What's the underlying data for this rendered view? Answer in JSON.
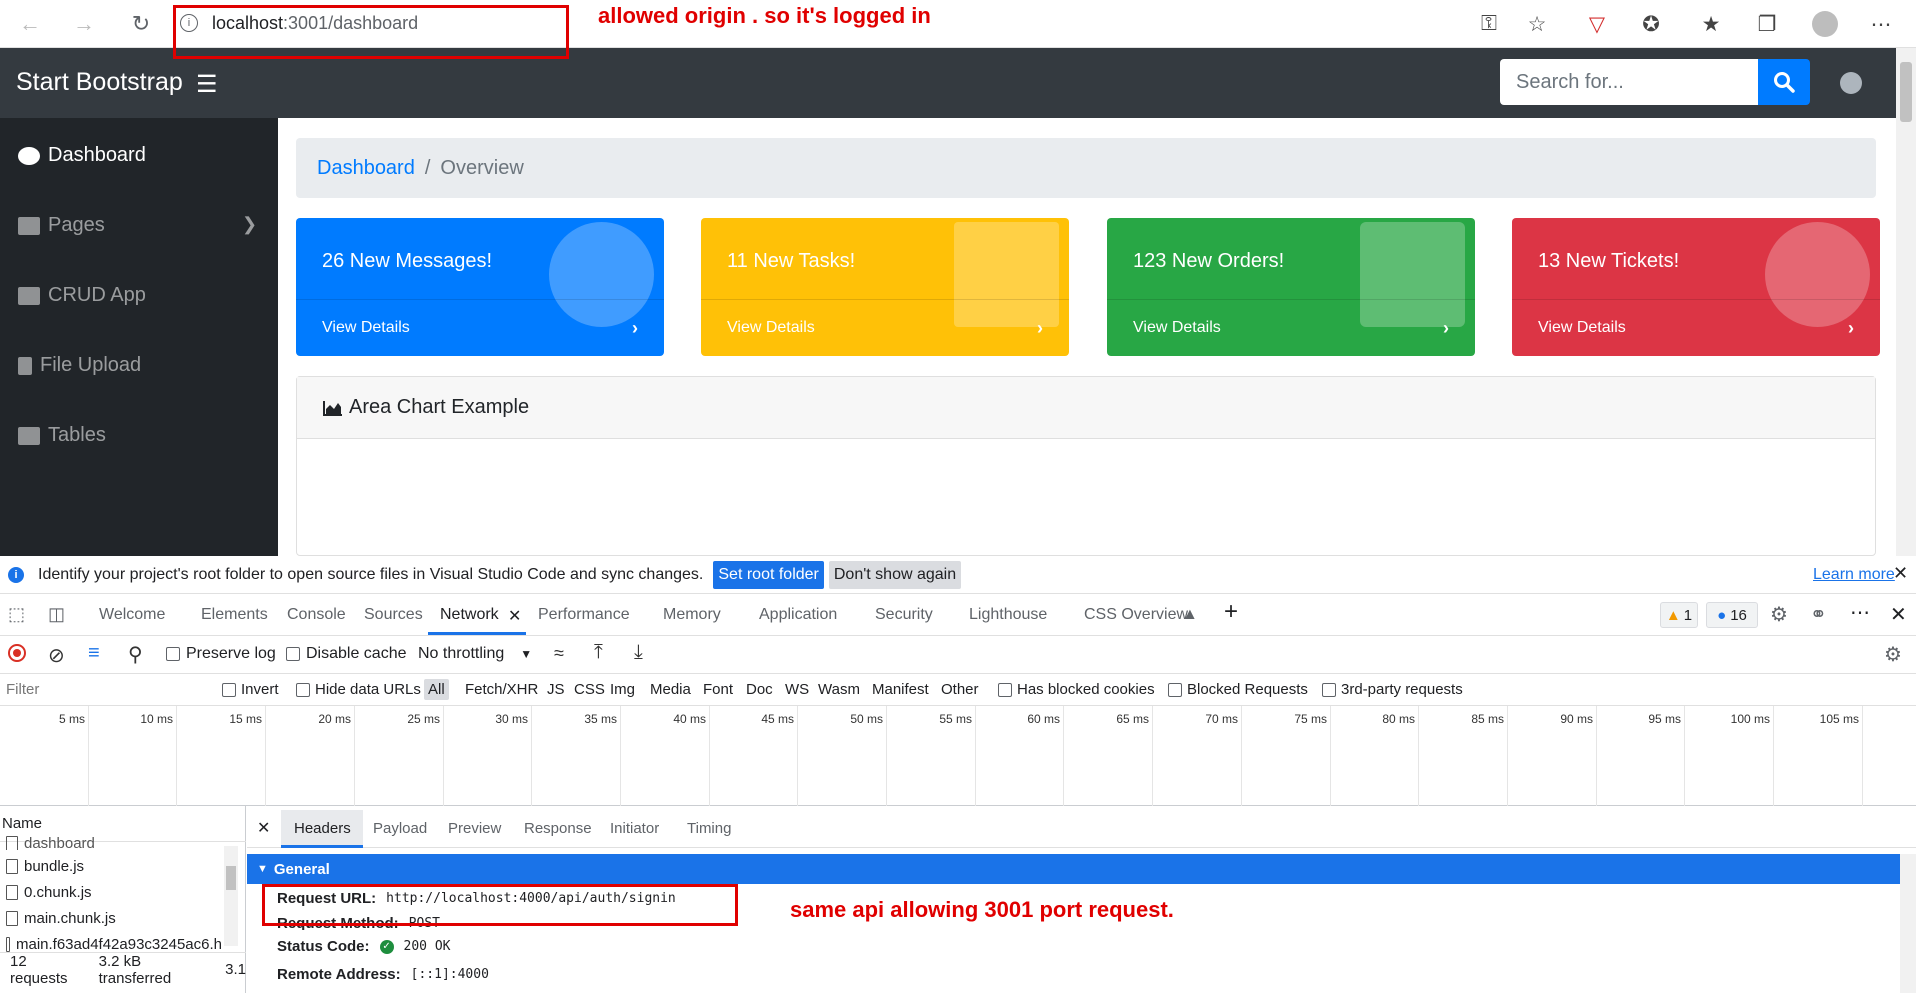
{
  "browser": {
    "url_host": "localhost",
    "url_path": ":3001/dashboard",
    "annotation_top": "allowed origin . so it's logged in"
  },
  "app": {
    "brand": "Start Bootstrap",
    "search_placeholder": "Search for..."
  },
  "sidebar": {
    "items": [
      {
        "label": "Dashboard"
      },
      {
        "label": "Pages"
      },
      {
        "label": "CRUD App"
      },
      {
        "label": "File Upload"
      },
      {
        "label": "Tables"
      }
    ]
  },
  "breadcrumb": {
    "link": "Dashboard",
    "sep": "/",
    "current": "Overview"
  },
  "cards": [
    {
      "title": "26 New Messages!",
      "footer": "View Details",
      "color": "#007bff"
    },
    {
      "title": "11 New Tasks!",
      "footer": "View Details",
      "color": "#ffc107"
    },
    {
      "title": "123 New Orders!",
      "footer": "View Details",
      "color": "#28a745"
    },
    {
      "title": "13 New Tickets!",
      "footer": "View Details",
      "color": "#dc3545"
    }
  ],
  "chart_card": {
    "title": "Area Chart Example"
  },
  "infobar": {
    "text": "Identify your project's root folder to open source files in Visual Studio Code and sync changes.",
    "set_root": "Set root folder",
    "dont_show": "Don't show again",
    "learn_more": "Learn more"
  },
  "devtools": {
    "tabs": [
      "Welcome",
      "Elements",
      "Console",
      "Sources",
      "Network",
      "Performance",
      "Memory",
      "Application",
      "Security",
      "Lighthouse",
      "CSS Overview"
    ],
    "warnings": "1",
    "messages": "16",
    "toolbar": {
      "preserve_log": "Preserve log",
      "disable_cache": "Disable cache",
      "throttling": "No throttling"
    },
    "filter": {
      "placeholder": "Filter",
      "invert": "Invert",
      "hide_data_urls": "Hide data URLs",
      "types": [
        "All",
        "Fetch/XHR",
        "JS",
        "CSS",
        "Img",
        "Media",
        "Font",
        "Doc",
        "WS",
        "Wasm",
        "Manifest",
        "Other"
      ],
      "blocked_cookies": "Has blocked cookies",
      "blocked_requests": "Blocked Requests",
      "third_party": "3rd-party requests"
    },
    "timeline_ticks": [
      "5 ms",
      "10 ms",
      "15 ms",
      "20 ms",
      "25 ms",
      "30 ms",
      "35 ms",
      "40 ms",
      "45 ms",
      "50 ms",
      "55 ms",
      "60 ms",
      "65 ms",
      "70 ms",
      "75 ms",
      "80 ms",
      "85 ms",
      "90 ms",
      "95 ms",
      "100 ms",
      "105 ms"
    ],
    "requests": {
      "header": "Name",
      "items": [
        "dashboard",
        "bundle.js",
        "0.chunk.js",
        "main.chunk.js",
        "main.f63ad4f42a93c3245ac6.h"
      ],
      "status_requests": "12 requests",
      "status_transferred": "3.2 kB transferred",
      "status_extra": "3.1"
    },
    "detail_tabs": [
      "Headers",
      "Payload",
      "Preview",
      "Response",
      "Initiator",
      "Timing"
    ],
    "general": {
      "title": "General",
      "request_url_key": "Request URL:",
      "request_url": "http://localhost:4000/api/auth/signin",
      "request_method_key": "Request Method:",
      "request_method": "POST",
      "status_code_key": "Status Code:",
      "status_code": "200 OK",
      "remote_address_key": "Remote Address:",
      "remote_address": "[::1]:4000"
    },
    "annotation_bottom": "same api allowing 3001 port request."
  }
}
